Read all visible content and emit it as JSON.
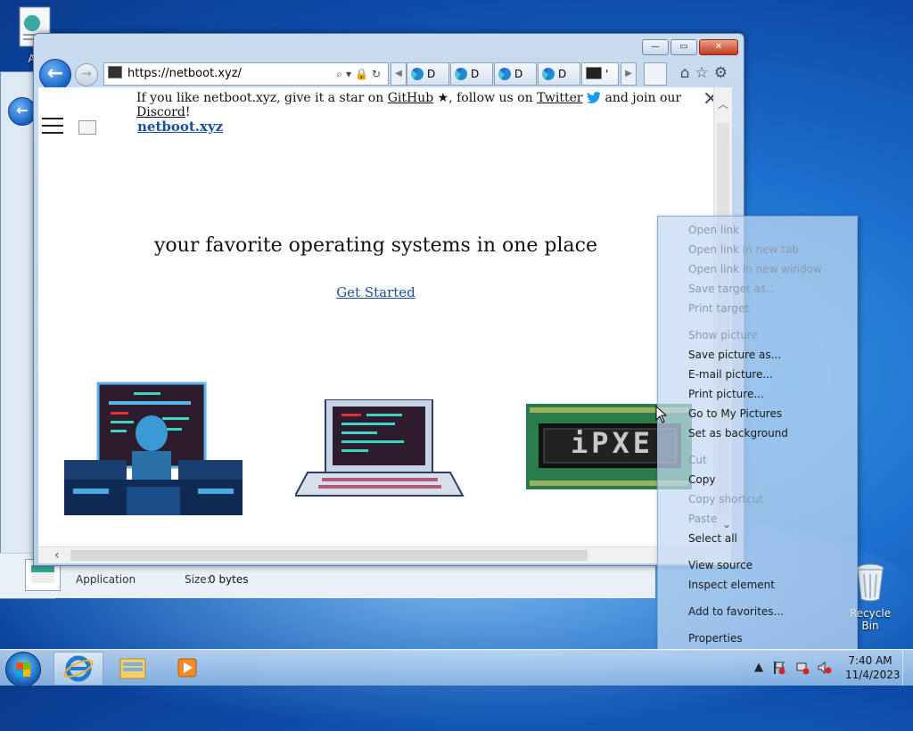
{
  "desktop": {
    "icon_top_left_label": "AN",
    "recycle_bin_label": "Recycle Bin"
  },
  "explorer_status": {
    "type_label": "Application",
    "size_label": "Size:",
    "size_value": "0 bytes"
  },
  "browser": {
    "window_buttons": {
      "minimize": "—",
      "maximize": "▭",
      "close": "✕"
    },
    "address": "https://netboot.xyz/",
    "address_tools": "⌕▾🔒↻",
    "tabs": [
      {
        "label": "D",
        "icon": "edge-icon"
      },
      {
        "label": "D",
        "icon": "edge-icon"
      },
      {
        "label": "D",
        "icon": "edge-icon"
      },
      {
        "label": "D",
        "icon": "edge-icon"
      },
      {
        "label": "'",
        "icon": "terminal-icon"
      }
    ],
    "command_icons": [
      "home-icon",
      "favorites-star-icon",
      "settings-gear-icon"
    ]
  },
  "page": {
    "banner": {
      "text1": "If you like netboot.xyz, give it a star on ",
      "github": "GitHub",
      "star": " ★",
      "text2": ", follow us on ",
      "twitter": "Twitter",
      "text3": " and join our ",
      "discord": "Discord",
      "text4": "!"
    },
    "banner_close": "✕",
    "site_name": "netboot.xyz",
    "tagline": "your favorite operating systems in one place",
    "cta": "Get Started",
    "ipxe_text": "iPXE"
  },
  "context_menu": {
    "items": [
      {
        "label": "Open link",
        "enabled": false
      },
      {
        "label": "Open link in new tab",
        "enabled": false
      },
      {
        "label": "Open link in new window",
        "enabled": false
      },
      {
        "label": "Save target as...",
        "enabled": false
      },
      {
        "label": "Print target",
        "enabled": false
      },
      {
        "label": "Show picture",
        "enabled": false
      },
      {
        "label": "Save picture as...",
        "enabled": true
      },
      {
        "label": "E-mail picture...",
        "enabled": true
      },
      {
        "label": "Print picture...",
        "enabled": true
      },
      {
        "label": "Go to My Pictures",
        "enabled": true
      },
      {
        "label": "Set as background",
        "enabled": true
      },
      {
        "label": "Cut",
        "enabled": false
      },
      {
        "label": "Copy",
        "enabled": true
      },
      {
        "label": "Copy shortcut",
        "enabled": false
      },
      {
        "label": "Paste",
        "enabled": false
      },
      {
        "label": "Select all",
        "enabled": true
      },
      {
        "label": "View source",
        "enabled": true
      },
      {
        "label": "Inspect element",
        "enabled": true
      },
      {
        "label": "Add to favorites...",
        "enabled": true
      },
      {
        "label": "Properties",
        "enabled": true
      }
    ]
  },
  "taskbar": {
    "time": "7:40 AM",
    "date": "11/4/2023",
    "tray_expand": "▲"
  },
  "colors": {
    "link": "#1a4f9f",
    "disabled_menu_text": "#8a9ab0",
    "close_button": "#c43a20"
  }
}
